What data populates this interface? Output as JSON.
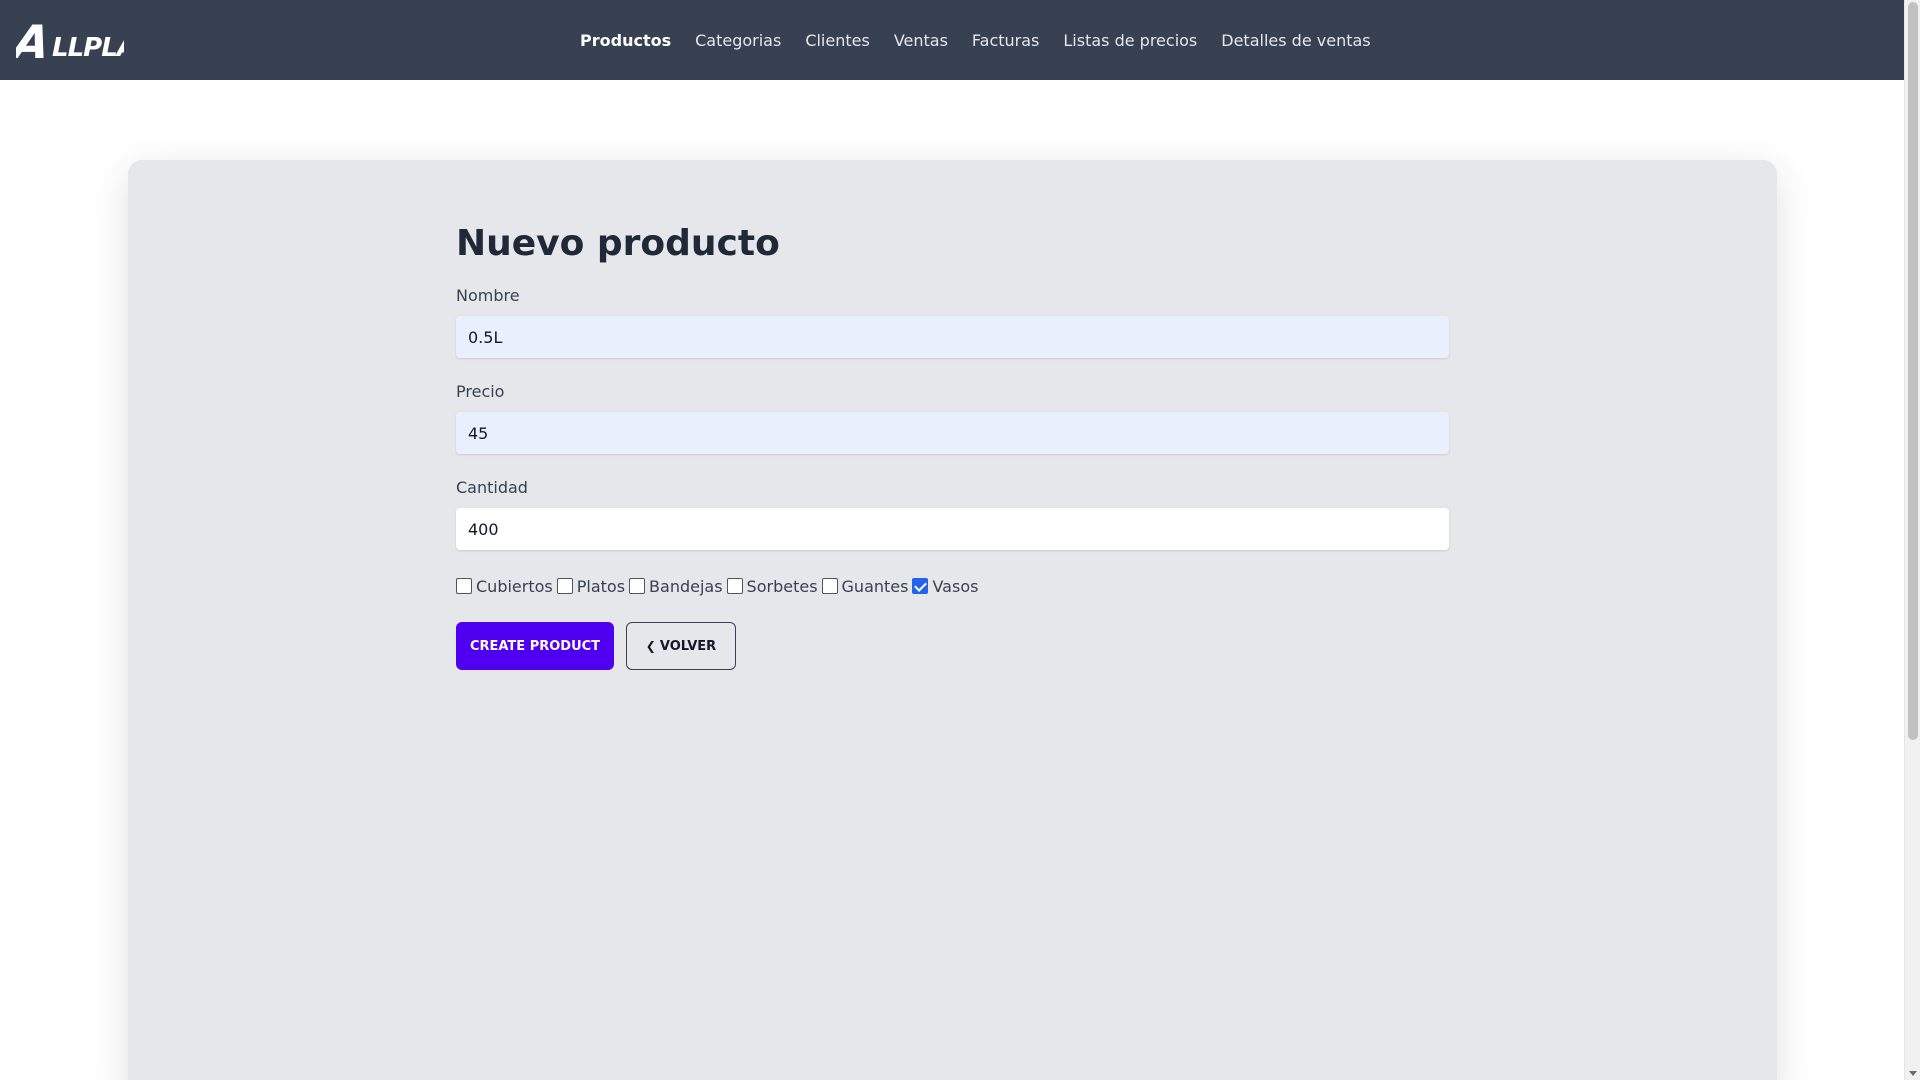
{
  "brand": {
    "logo_text": "ALLPLAST"
  },
  "nav": {
    "items": [
      {
        "label": "Productos",
        "active": true
      },
      {
        "label": "Categorias"
      },
      {
        "label": "Clientes"
      },
      {
        "label": "Ventas"
      },
      {
        "label": "Facturas"
      },
      {
        "label": "Listas de precios"
      },
      {
        "label": "Detalles de ventas"
      }
    ]
  },
  "form": {
    "title": "Nuevo producto",
    "fields": {
      "nombre": {
        "label": "Nombre",
        "value": "0.5L"
      },
      "precio": {
        "label": "Precio",
        "value": "45"
      },
      "cantidad": {
        "label": "Cantidad",
        "value": "400"
      }
    },
    "categories": [
      {
        "label": "Cubiertos",
        "checked": false
      },
      {
        "label": "Platos",
        "checked": false
      },
      {
        "label": "Bandejas",
        "checked": false
      },
      {
        "label": "Sorbetes",
        "checked": false
      },
      {
        "label": "Guantes",
        "checked": false
      },
      {
        "label": "Vasos",
        "checked": true
      }
    ],
    "submit_label": "Create Product",
    "back_label": "Volver",
    "back_icon": "chevron-left-icon"
  },
  "colors": {
    "navbar": "#374151",
    "card": "#e5e7eb",
    "primary_button": "#4f00f0",
    "checkbox_checked": "#2563eb",
    "autofill": "#e8f0fe"
  }
}
